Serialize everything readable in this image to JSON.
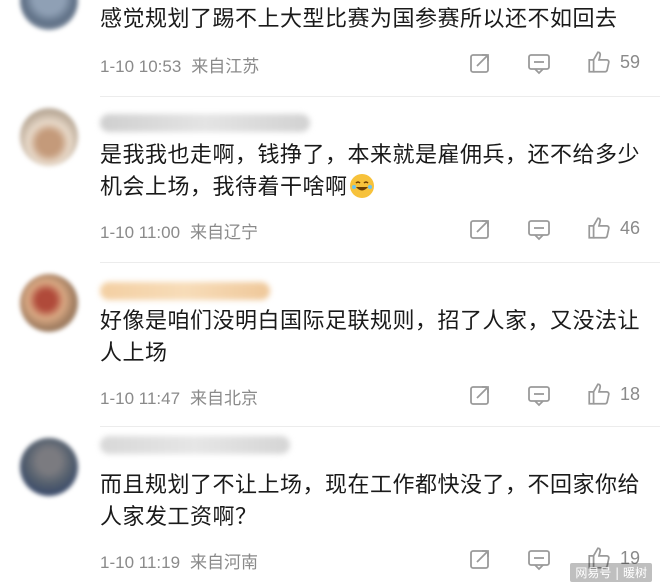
{
  "comments": [
    {
      "text": "感觉规划了踢不上大型比赛为国参赛所以还不如回去",
      "date": "1-10 10:53",
      "location": "来自江苏",
      "likes": "59"
    },
    {
      "text": "是我我也走啊，钱挣了，本来就是雇佣兵，还不给多少机会上场，我待着干啥啊",
      "emoji": "laughing-tears-emoji",
      "date": "1-10 11:00",
      "location": "来自辽宁",
      "likes": "46"
    },
    {
      "text": "好像是咱们没明白国际足联规则，招了人家，又没法让人上场",
      "date": "1-10 11:47",
      "location": "来自北京",
      "likes": "18"
    },
    {
      "text": "而且规划了不让上场，现在工作都快没了，不回家你给人家发工资啊？",
      "date": "1-10 11:19",
      "location": "来自河南",
      "likes": "19"
    }
  ],
  "watermark": "网易号 | 暖树",
  "colors": {
    "meta": "#8a8a8a",
    "text": "#1a1a1a",
    "icon": "#9a9a9a"
  }
}
